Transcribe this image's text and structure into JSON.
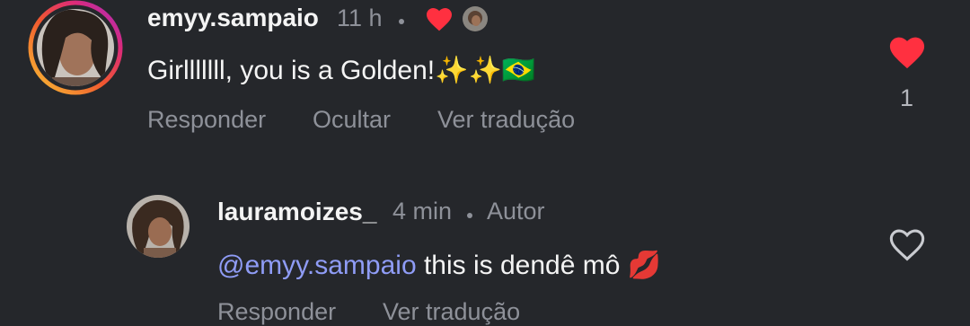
{
  "comment": {
    "username": "emyy.sampaio",
    "time": "11 h",
    "text": "Girlllllll, you is a Golden!✨✨🇧🇷",
    "actions": {
      "reply": "Responder",
      "hide": "Ocultar",
      "translate": "Ver tradução"
    },
    "like_count": "1",
    "liked": true
  },
  "reply": {
    "username": "lauramoizes_",
    "time": "4 min",
    "author_badge": "Autor",
    "mention": "@emyy.sampaio",
    "text": " this is dendê mô 💋",
    "actions": {
      "reply": "Responder",
      "translate": "Ver tradução"
    },
    "liked": false
  },
  "colors": {
    "background": "#25272b",
    "like_red": "#ff3040",
    "mention_blue": "#8f9cf6",
    "secondary_text": "#8e9199"
  },
  "icons": [
    "heart-filled-icon",
    "heart-outline-icon",
    "author-liked-heart-icon",
    "story-ring"
  ]
}
